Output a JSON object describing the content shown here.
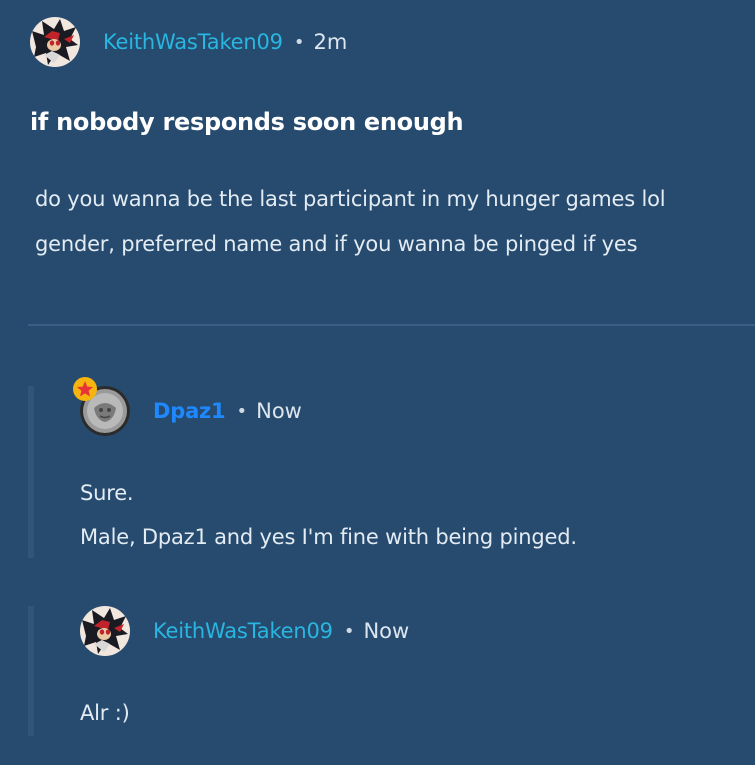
{
  "post": {
    "author": "KeithWasTaken09",
    "separator": "•",
    "time": "2m",
    "title": "if nobody responds soon enough",
    "body_lines": [
      "do you wanna be the last participant in my hunger games lol",
      "gender, preferred name and if you wanna be pinged if yes"
    ]
  },
  "replies": [
    {
      "author": "Dpaz1",
      "separator": "•",
      "time": "Now",
      "lines": [
        "Sure.",
        "Male, Dpaz1 and yes I'm fine with being pinged."
      ],
      "author_color": "#1e88ff"
    },
    {
      "author": "KeithWasTaken09",
      "separator": "•",
      "time": "Now",
      "lines": [
        "Alr :)"
      ],
      "author_color": "#29b6e0"
    }
  ],
  "colors": {
    "background": "#274b6f",
    "divider": "#3a5f84",
    "rail": "#2f5678"
  },
  "icons": {
    "post_avatar": "shadow-hedgehog-avatar",
    "reply1_avatar": "gray-coin-avatar",
    "reply1_badge": "star-badge-icon"
  }
}
